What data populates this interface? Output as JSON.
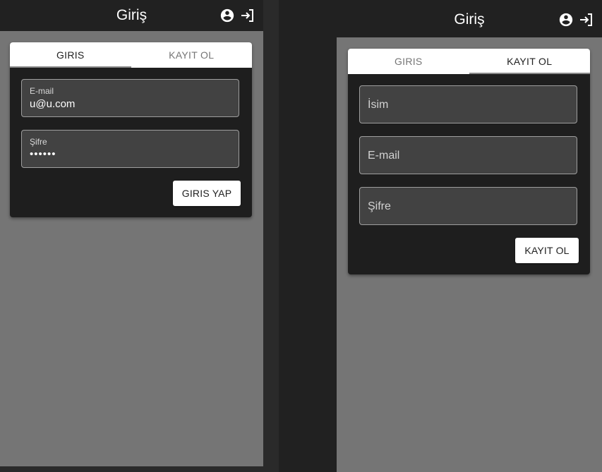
{
  "left": {
    "appbar": {
      "title": "Giriş"
    },
    "tabs": [
      {
        "label": "GIRIS"
      },
      {
        "label": "KAYIT OL"
      }
    ],
    "form": {
      "email": {
        "label": "E-mail",
        "value": "u@u.com"
      },
      "password": {
        "label": "Şifre",
        "value": "••••••"
      },
      "submit_label": "GIRIS YAP"
    }
  },
  "right": {
    "appbar": {
      "title": "Giriş"
    },
    "tabs": [
      {
        "label": "GIRIS"
      },
      {
        "label": "KAYIT OL"
      }
    ],
    "form": {
      "name": {
        "placeholder": "İsim"
      },
      "email": {
        "placeholder": "E-mail"
      },
      "password": {
        "placeholder": "Şifre"
      },
      "submit_label": "KAYIT OL"
    }
  },
  "icons": {
    "account": "account-circle-icon",
    "login": "login-icon"
  },
  "colors": {
    "appbar": "#212121",
    "page": "#757575",
    "card": "#1e1e1e",
    "field": "#424242"
  }
}
